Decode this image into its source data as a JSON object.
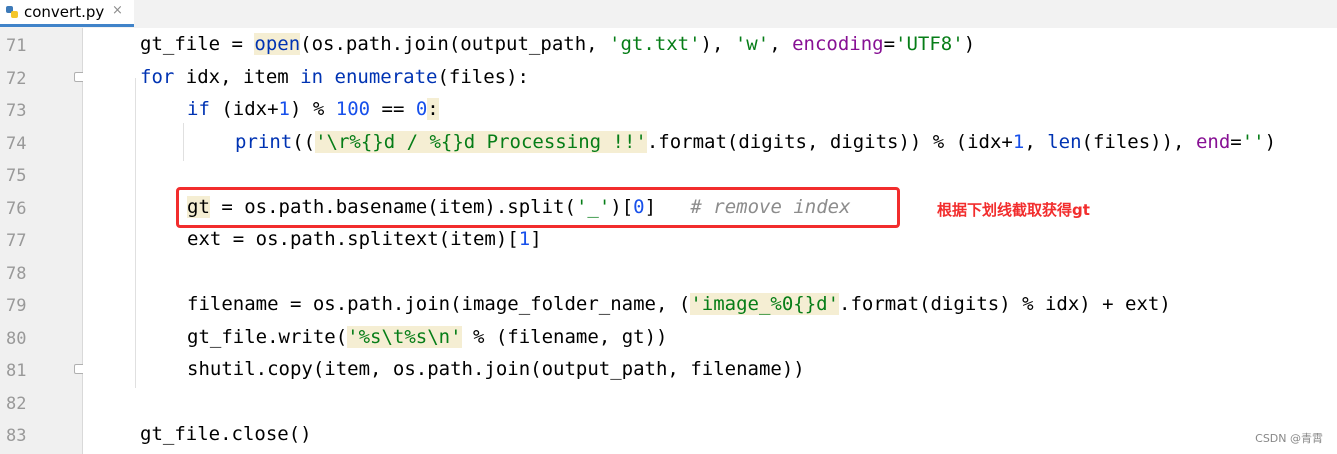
{
  "tab": {
    "label": "convert.py",
    "close": "×"
  },
  "line_numbers": [
    "71",
    "72",
    "73",
    "74",
    "75",
    "76",
    "77",
    "78",
    "79",
    "80",
    "81",
    "82",
    "83"
  ],
  "annotation": "根据下划线截取获得gt",
  "watermark": "CSDN @青霄",
  "code": {
    "l71": {
      "a": "gt_file = ",
      "b": "open",
      "c": "(os.path.join(output_path, ",
      "d": "'gt.txt'",
      "e": "), ",
      "f": "'w'",
      "g": ", ",
      "h": "encoding",
      "i": "=",
      "j": "'UTF8'",
      "k": ")"
    },
    "l72": {
      "a": "for",
      "b": " idx, item ",
      "c": "in",
      "d": " ",
      "e": "enumerate",
      "f": "(files):"
    },
    "l73": {
      "a": "if",
      "b": " (idx+",
      "c": "1",
      "d": ") % ",
      "e": "100",
      "f": " == ",
      "g": "0",
      "h": ":"
    },
    "l74": {
      "a": "print",
      "b": "((",
      "c": "'\\r%{}d / %{}d Processing !!'",
      "d": ".format(digits, digits)) % (idx+",
      "e": "1",
      "f": ", ",
      "g": "len",
      "h": "(files)), ",
      "i": "end",
      "j": "=",
      "k": "''",
      "l": ")"
    },
    "l76": {
      "a": "gt",
      "b": " = os.path.basename(item).split(",
      "c": "'_'",
      "d": ")[",
      "e": "0",
      "f": "]   ",
      "g": "# remove index"
    },
    "l77": {
      "a": "ext = os.path.splitext(item)[",
      "b": "1",
      "c": "]"
    },
    "l79": {
      "a": "filename = os.path.join(image_folder_name, (",
      "b": "'image_%0{}d'",
      "c": ".format(digits) % idx) + ext)"
    },
    "l80": {
      "a": "gt_file.write(",
      "b": "'%s\\t%s\\n'",
      "c": " % (filename, gt))"
    },
    "l81": {
      "a": "shutil.copy(item, os.path.join(output_path, filename))"
    },
    "l83": {
      "a": "gt_file.close()"
    }
  }
}
